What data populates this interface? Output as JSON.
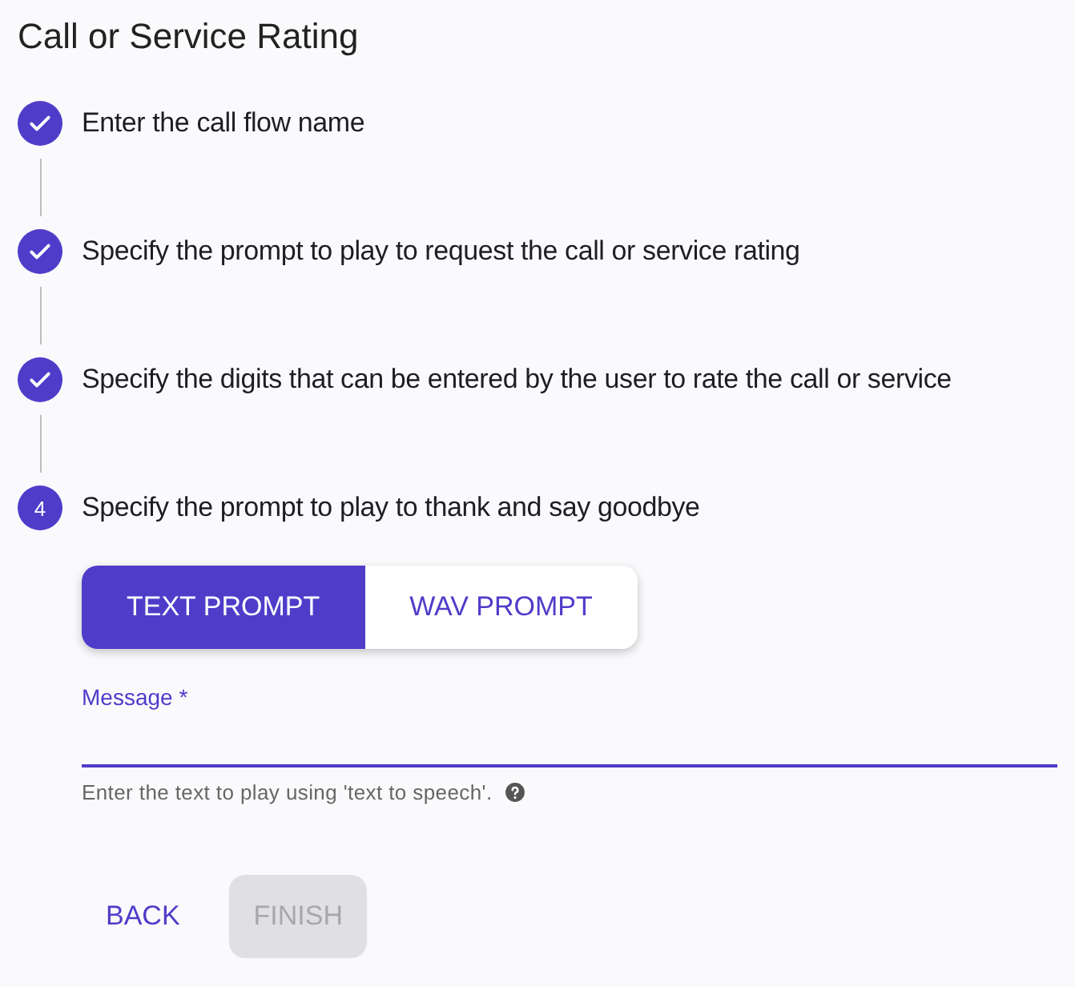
{
  "title": "Call or Service Rating",
  "steps": [
    {
      "label": "Enter the call flow name",
      "completed": true
    },
    {
      "label": "Specify the prompt to play to request the call or service rating",
      "completed": true
    },
    {
      "label": "Specify the digits that can be entered by the user to rate the call or service",
      "completed": true
    },
    {
      "label": "Specify the prompt to play to thank and say goodbye",
      "completed": false,
      "number": "4"
    }
  ],
  "prompt_types": [
    {
      "label": "TEXT PROMPT",
      "selected": true
    },
    {
      "label": "WAV PROMPT",
      "selected": false
    }
  ],
  "message_field": {
    "label": "Message *",
    "focused": true,
    "helper": "Enter the text to play using 'text to speech'."
  },
  "buttons": [
    {
      "label": "BACK",
      "disabled": false
    },
    {
      "label": "FINISH",
      "disabled": true
    }
  ]
}
